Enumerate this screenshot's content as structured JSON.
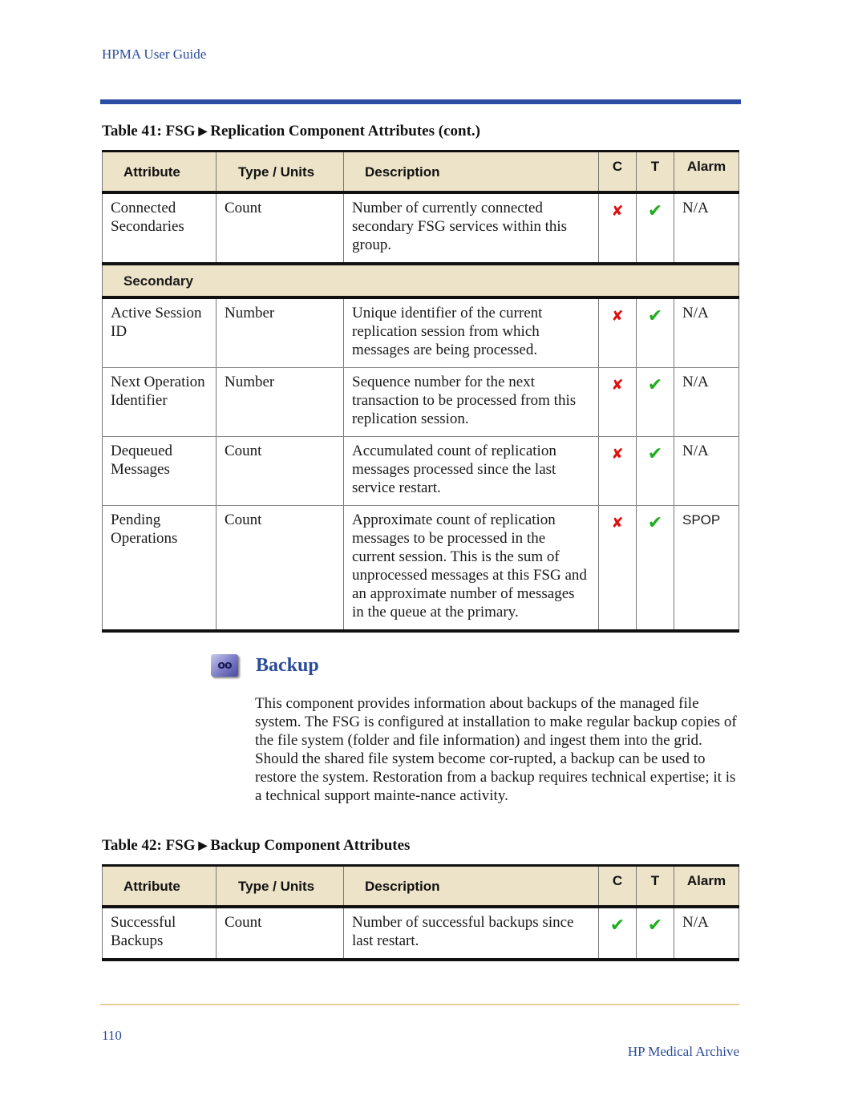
{
  "header": {
    "running_head": "HPMA User Guide"
  },
  "table41": {
    "caption_prefix": "Table 41: FSG",
    "caption_arrow": "▶",
    "caption_suffix": "Replication Component Attributes (cont.)",
    "columns": [
      "Attribute",
      "Type / Units",
      "Description",
      "C",
      "T",
      "Alarm"
    ],
    "rows_top": [
      {
        "attribute": "Connected Secondaries",
        "type": "Count",
        "description": "Number of currently connected secondary FSG services within this group.",
        "c": "cross",
        "t": "check",
        "alarm": "N/A"
      }
    ],
    "section_label": "Secondary",
    "rows_section": [
      {
        "attribute": "Active Session ID",
        "type": "Number",
        "description": "Unique identifier of the current replication session from which messages are being processed.",
        "c": "cross",
        "t": "check",
        "alarm": "N/A"
      },
      {
        "attribute": "Next Operation Identifier",
        "type": "Number",
        "description": "Sequence number for the next transaction to be processed from this replication session.",
        "c": "cross",
        "t": "check",
        "alarm": "N/A"
      },
      {
        "attribute": "Dequeued Messages",
        "type": "Count",
        "description": "Accumulated count of replication messages processed since the last service restart.",
        "c": "cross",
        "t": "check",
        "alarm": "N/A"
      },
      {
        "attribute": "Pending Operations",
        "type": "Count",
        "description": "Approximate count of replication messages to be processed in the current session. This is the sum of unprocessed messages at this FSG and an approximate number of messages in the queue at the primary.",
        "c": "cross",
        "t": "check",
        "alarm": "SPOP"
      }
    ]
  },
  "backup_section": {
    "icon": "backup-tape-icon",
    "icon_glyph": "oo",
    "title": "Backup",
    "paragraph": "This component provides information about backups of the managed file system. The FSG is configured at installation to make regular backup copies of the file system (folder and file information) and ingest them into the grid. Should the shared file system become cor-rupted, a backup can be used to restore the system. Restoration from a backup requires technical expertise; it is a technical support mainte-nance activity."
  },
  "table42": {
    "caption_prefix": "Table 42: FSG",
    "caption_arrow": "▶",
    "caption_suffix": "Backup Component Attributes",
    "columns": [
      "Attribute",
      "Type / Units",
      "Description",
      "C",
      "T",
      "Alarm"
    ],
    "rows": [
      {
        "attribute": "Successful Backups",
        "type": "Count",
        "description": "Number of successful backups since last restart.",
        "c": "check",
        "t": "check",
        "alarm": "N/A"
      }
    ]
  },
  "icons": {
    "check": "✔",
    "cross": "✘"
  },
  "colors": {
    "brand_blue": "#2b4c9a",
    "header_fill": "#ede3c8",
    "check_green": "#1fae1f",
    "cross_red": "#e01010",
    "footer_rule": "#e3cf94"
  },
  "footer": {
    "page_number": "110",
    "title": "HP Medical Archive"
  }
}
